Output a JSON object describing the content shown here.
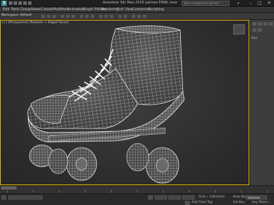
{
  "window": {
    "title": "Autodesk 3ds Max 2016     patines FINAL.max",
    "search_placeholder": "Type a keyword or phrase",
    "minimize": "–",
    "maximize": "□",
    "close": "✕"
  },
  "menubar": {
    "items": [
      "Edit",
      "Tools",
      "Group",
      "Views",
      "Create",
      "Modifiers",
      "Animation",
      "Graph Editors",
      "Rendering",
      "Civil View",
      "Customize",
      "Scripting"
    ]
  },
  "toolbar": {
    "workspace_label": "Workspace: Default"
  },
  "viewport": {
    "label": "[+] [Perspective] [Realistic + Edged Faces]",
    "border_color": "#f0c000",
    "model": "roller-skate-wireframe",
    "wire_color": "#e6e6e6"
  },
  "side_panel": {
    "label": "Mod"
  },
  "timeline": {
    "ticks": [
      "0",
      "10",
      "20",
      "30",
      "40",
      "50",
      "60",
      "70",
      "80",
      "90",
      "100"
    ]
  },
  "status": {
    "grid": "Grid = 100,0mm",
    "add_time_tag": "Add Time Tag",
    "auto_key": "Auto Key",
    "set_key": "Set Key",
    "selected": "Selected",
    "key_filters": "Key Filters..."
  }
}
